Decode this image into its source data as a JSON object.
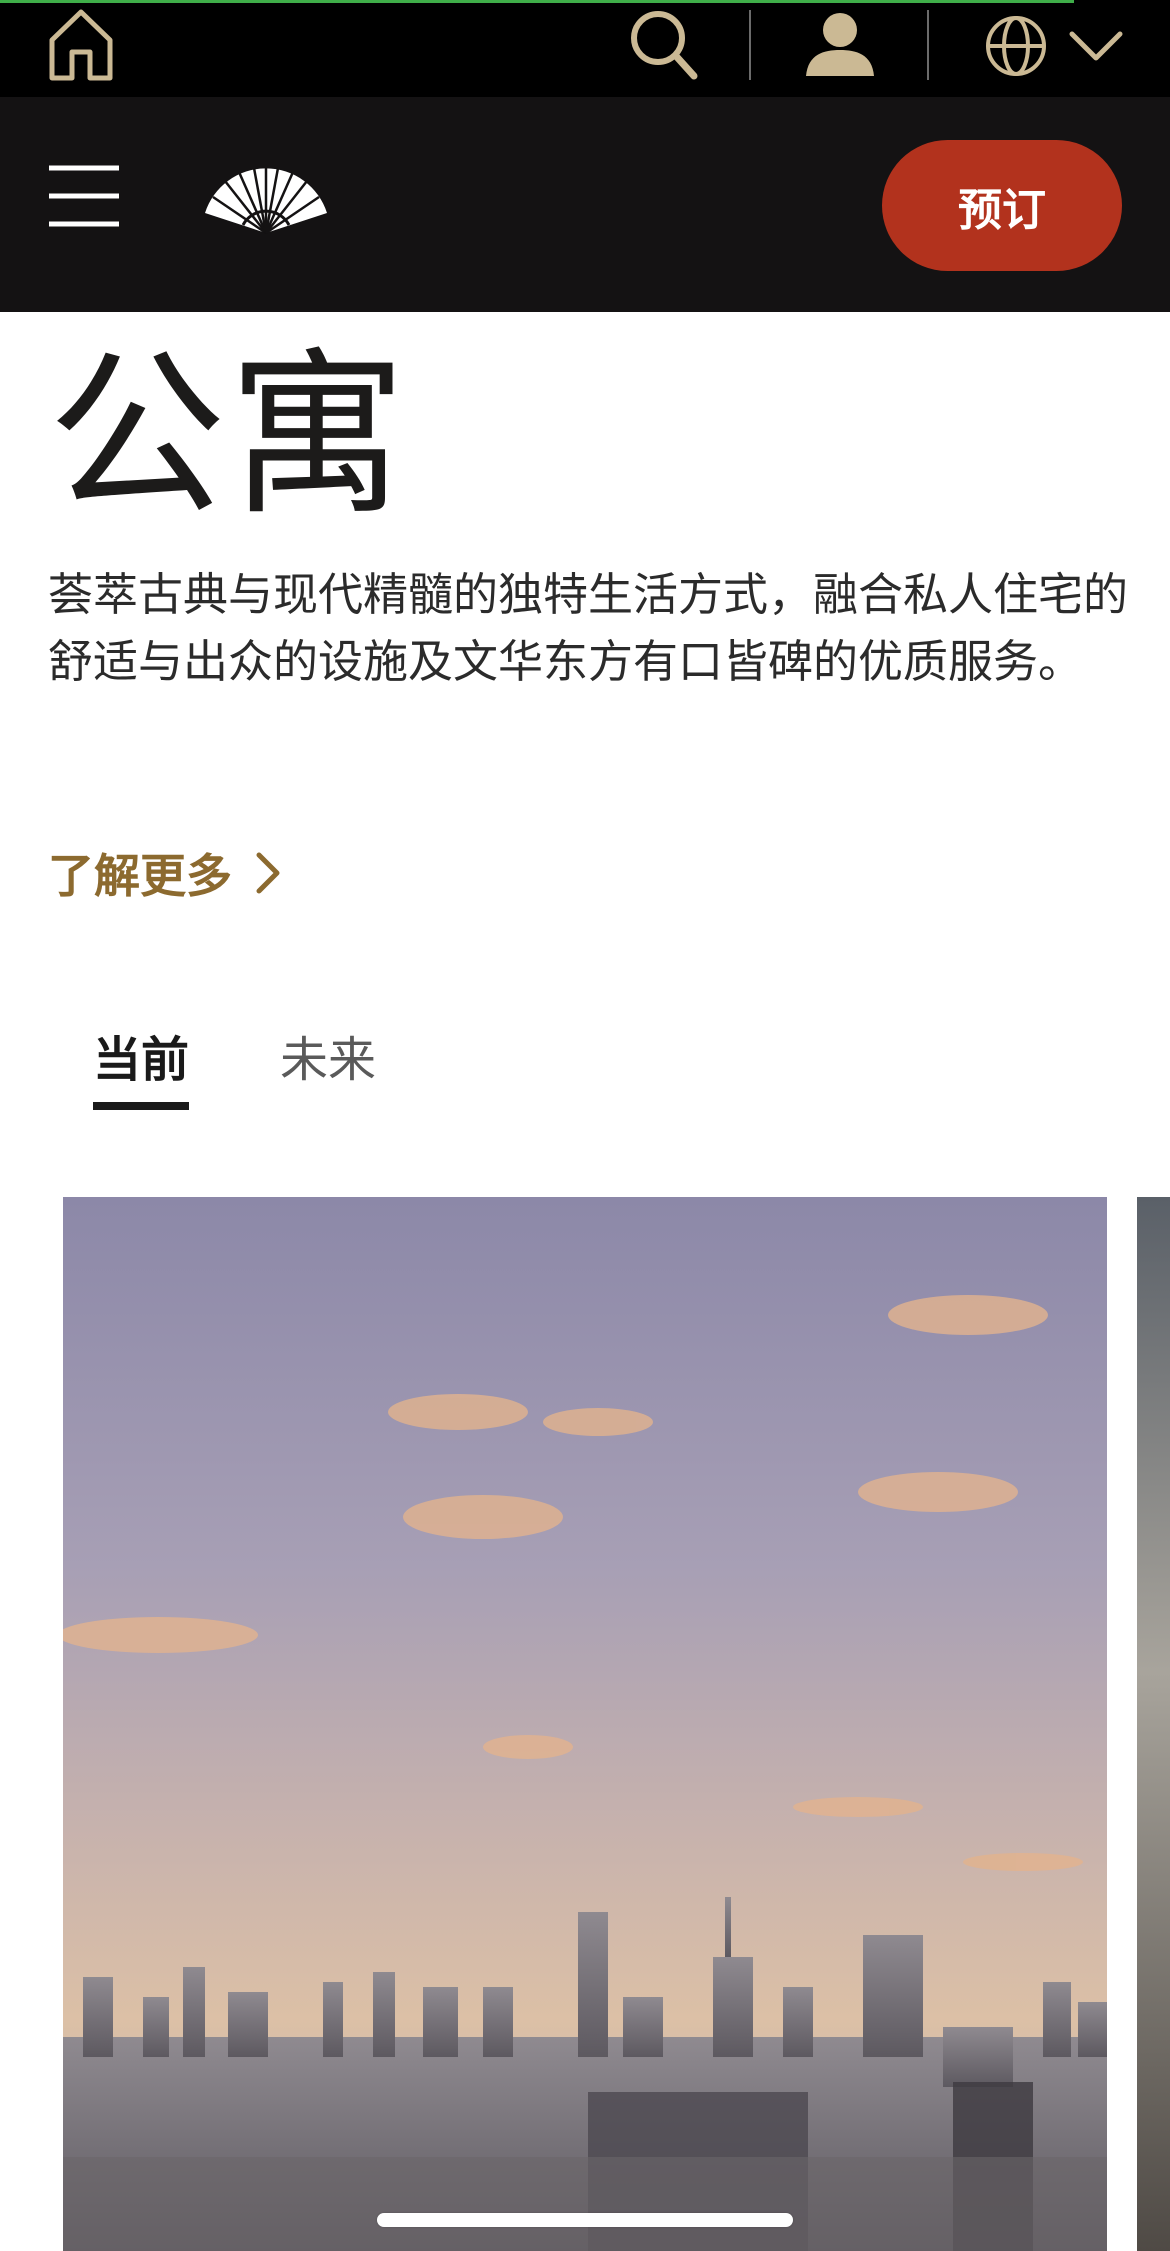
{
  "header": {
    "book_label": "预订"
  },
  "main": {
    "title": "公寓",
    "description": "荟萃古典与现代精髓的独特生活方式，融合私人住宅的舒适与出众的设施及文华东方有口皆碑的优质服务。",
    "learn_more_label": "了解更多"
  },
  "tabs": [
    {
      "label": "当前",
      "selected": true
    },
    {
      "label": "未来",
      "selected": false
    }
  ],
  "colors": {
    "top_bar": "#000000",
    "header": "#141213",
    "book_button": "#b2321d",
    "link_gold": "#8c6a2f",
    "icon_gold": "#cbb994"
  },
  "icons": {
    "home": "home-icon",
    "search": "search-icon",
    "account": "user-icon",
    "language": "globe-icon",
    "language_toggle": "chevron-down-icon",
    "menu": "hamburger-menu-icon",
    "logo": "fan-logo-icon",
    "learn_more": "chevron-right-icon"
  }
}
